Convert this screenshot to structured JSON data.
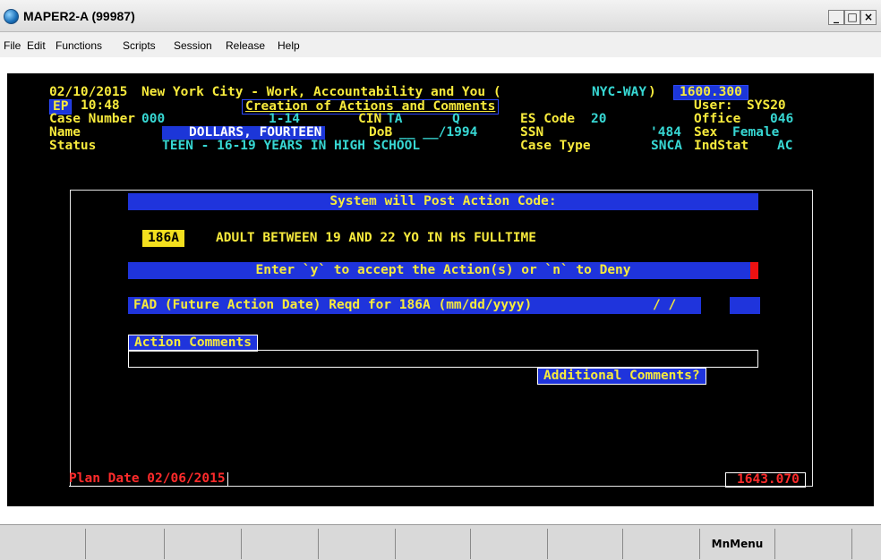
{
  "window": {
    "title": "MAPER2-A (99987)",
    "min": "_",
    "max": "□",
    "close": "×"
  },
  "menu": [
    {
      "label": "File"
    },
    {
      "label": "Edit"
    },
    {
      "label": "Functions"
    },
    {
      "label": "Scripts"
    },
    {
      "label": "Session"
    },
    {
      "label": "Release"
    },
    {
      "label": "Help"
    }
  ],
  "header": {
    "date": "02/10/2015",
    "system_title": "New York City - Work, Accountability and You (",
    "nycway": "NYC-WAY",
    "close_paren": ")",
    "code": "1600.300",
    "ep": "EP",
    "time": "10:48",
    "screen_title": "Creation of Actions and Comments",
    "user_label": "User:",
    "user": "SYS20",
    "case_number_label": "Case Number",
    "case_number": "000",
    "case_suffix": "1-14",
    "cin_label": "CIN",
    "cin": "TA",
    "cin_suffix": "Q",
    "es_code_label": "ES Code",
    "es_code": "20",
    "office_label": "Office",
    "office": "046",
    "name_label": "Name",
    "name": "DOLLARS, FOURTEEN",
    "dob_label": "DoB",
    "dob": "__ __/1994",
    "ssn_label": "SSN",
    "ssn": "'484",
    "sex_label": "Sex",
    "sex": "Female",
    "status_label": "Status",
    "status": "TEEN - 16-19 YEARS IN HIGH SCHOOL",
    "case_type_label": "Case Type",
    "case_type": "SNCA",
    "indstat_label": "IndStat",
    "indstat": "AC"
  },
  "panel": {
    "post_title": "System will Post Action Code:",
    "action_code": "186A",
    "action_desc": "ADULT BETWEEN 19 AND 22 YO IN HS FULLTIME",
    "accept_prompt": "Enter `y` to accept the Action(s) or `n` to Deny",
    "fad_label": "FAD (Future Action Date) Reqd for 186A (mm/dd/yyyy)",
    "fad_value": " /  /",
    "action_comments_label": "Action Comments",
    "additional_comments": "Additional Comments?"
  },
  "footer": {
    "plan_date": "Plan Date 02/06/2015",
    "code": "1643.070"
  },
  "fkeys": [
    "",
    "",
    "",
    "",
    "",
    "",
    "",
    "",
    "",
    "MnMenu",
    "",
    ""
  ]
}
